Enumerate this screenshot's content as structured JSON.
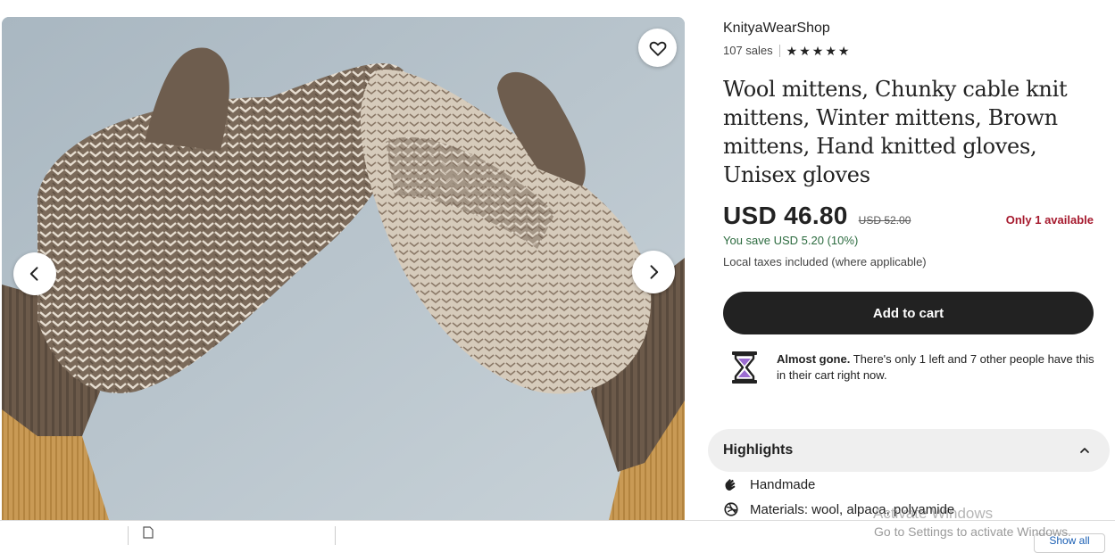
{
  "gallery": {
    "favorite_icon": "heart-outline-icon",
    "prev_icon": "chevron-left-icon",
    "next_icon": "chevron-right-icon",
    "colors": {
      "background": "#b9c5cd",
      "mitten_brown": "#6b5a4c",
      "mitten_light": "#e4dccf",
      "cuff_tan": "#c99a55"
    }
  },
  "shop": {
    "name": "KnityaWearShop",
    "sales": "107 sales",
    "stars": [
      "★",
      "★",
      "★",
      "★",
      "★"
    ]
  },
  "product": {
    "title": "Wool mittens, Chunky cable knit mittens, Winter mittens, Brown mittens, Hand knitted gloves, Unisex gloves",
    "price": "USD 46.80",
    "original_price": "USD 52.00",
    "availability": "Only 1 available",
    "you_save": "You save USD 5.20 (10%)",
    "taxes": "Local taxes included (where applicable)",
    "add_to_cart": "Add to cart"
  },
  "alert": {
    "bold": "Almost gone.",
    "text": " There's only 1 left and 7 other people have this in their cart right now.",
    "icon": "hourglass-icon"
  },
  "highlights": {
    "label": "Highlights",
    "items": [
      {
        "icon": "hand-icon",
        "label": "Handmade"
      },
      {
        "icon": "yarn-icon",
        "label": "Materials: wool, alpaca, polyamide"
      }
    ]
  },
  "watermark": {
    "line1": "Activate Windows",
    "line2": "Go to Settings to activate Windows."
  },
  "downloads_bar": {
    "show_all": "Show all"
  },
  "colors": {
    "accent": "#222222",
    "availability": "#a61a2e",
    "savings": "#2c6b3f",
    "highlights_bg": "#efefef"
  }
}
